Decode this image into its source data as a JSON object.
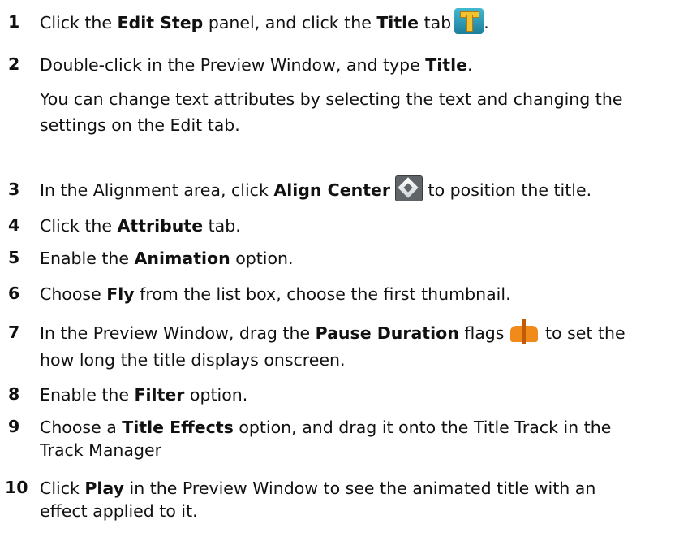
{
  "steps": [
    {
      "num": "1",
      "parts": [
        "Click the ",
        "Edit Step",
        " panel, and click the ",
        "Title",
        " tab",
        "."
      ]
    },
    {
      "num": "2",
      "parts": [
        "Double-click in the Preview Window, and type ",
        "Title",
        "."
      ],
      "note": "You can change text attributes by selecting the text and changing the settings on the Edit tab."
    },
    {
      "num": "3",
      "parts": [
        "In the Alignment area, click ",
        "Align Center",
        " to position the title."
      ]
    },
    {
      "num": "4",
      "parts": [
        "Click the ",
        "Attribute",
        " tab."
      ]
    },
    {
      "num": "5",
      "parts": [
        "Enable the ",
        "Animation",
        " option."
      ]
    },
    {
      "num": "6",
      "parts": [
        "Choose ",
        "Fly",
        " from the list box, choose the first thumbnail."
      ]
    },
    {
      "num": "7",
      "parts": [
        "In the Preview Window, drag the ",
        "Pause Duration",
        " flags",
        " to set the"
      ],
      "cont": "how long the title displays onscreen."
    },
    {
      "num": "8",
      "parts": [
        "Enable the ",
        "Filter",
        " option."
      ]
    },
    {
      "num": "9",
      "parts": [
        "Choose a ",
        "Title Effects",
        " option, and drag it onto the Title Track in the"
      ],
      "cont": "Track Manager"
    },
    {
      "num": "10",
      "parts": [
        "Click ",
        "Play",
        " in the Preview Window to see the animated title with an"
      ],
      "cont": "effect applied to it."
    }
  ],
  "icons": {
    "title_tab": "title-tab-icon",
    "align_center": "align-center-icon",
    "pause_flags": "pause-duration-flags-icon"
  }
}
